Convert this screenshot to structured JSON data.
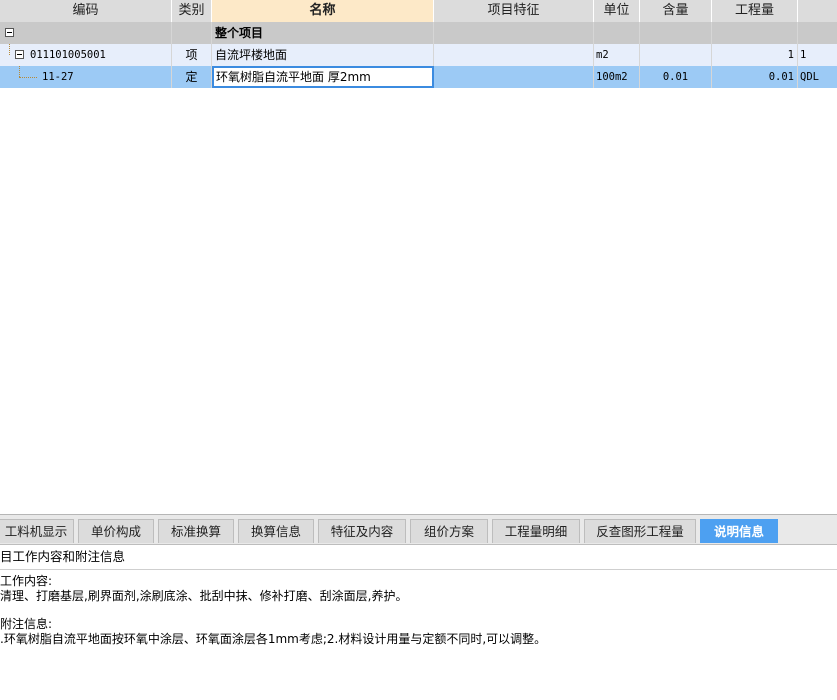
{
  "grid": {
    "headers": {
      "code": "编码",
      "category": "类别",
      "name": "名称",
      "feature": "项目特征",
      "unit": "单位",
      "content": "含量",
      "quantity": "工程量"
    },
    "rows": [
      {
        "code": "",
        "category": "",
        "name": "整个项目",
        "feature": "",
        "unit": "",
        "content": "",
        "quantity": "",
        "extra": ""
      },
      {
        "code": "011101005001",
        "category": "项",
        "name": "自流坪楼地面",
        "feature": "",
        "unit": "m2",
        "content": "",
        "quantity": "1",
        "extra": "1"
      },
      {
        "code": "11-27",
        "category": "定",
        "name": "环氧树脂自流平地面 厚2mm",
        "feature": "",
        "unit": "100m2",
        "content": "0.01",
        "quantity": "0.01",
        "extra": "QDL"
      }
    ]
  },
  "tabs": [
    "工料机显示",
    "单价构成",
    "标准换算",
    "换算信息",
    "特征及内容",
    "组价方案",
    "工程量明细",
    "反查图形工程量",
    "说明信息"
  ],
  "active_tab": "说明信息",
  "info": {
    "section_title": "目工作内容和附注信息",
    "work_label": "工作内容:",
    "work_text": "清理、打磨基层,刷界面剂,涂刷底涂、批刮中抹、修补打磨、刮涂面层,养护。",
    "note_label": "附注信息:",
    "note_text": ".环氧树脂自流平地面按环氧中涂层、环氧面涂层各1mm考虑;2.材料设计用量与定额不同时,可以调整。"
  },
  "colors": {
    "header_bg": "#dcdcdc",
    "active_header_bg": "#fde9c8",
    "selected_row": "#9ccaf5",
    "active_tab": "#4da0f1"
  }
}
